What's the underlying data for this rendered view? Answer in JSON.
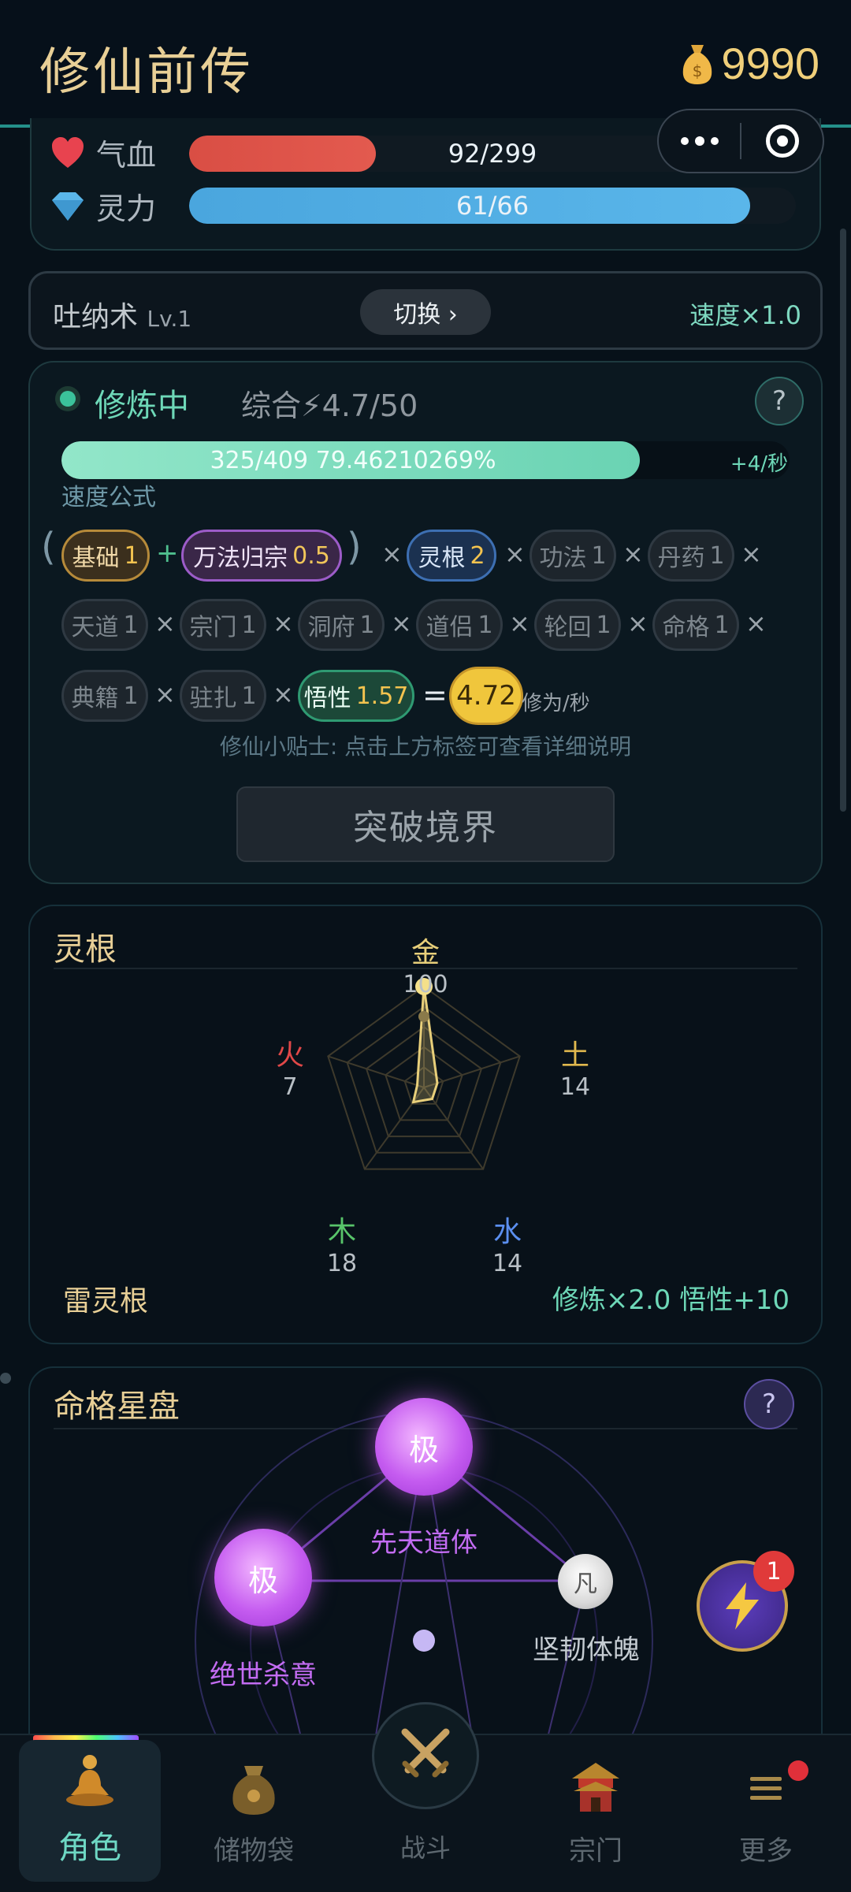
{
  "header": {
    "title": "修仙前传",
    "coins": "9990"
  },
  "stats": {
    "hp": {
      "label": "气血",
      "text": "92/299",
      "fraction": 0.3077,
      "color": "#e35a4f"
    },
    "mana": {
      "label": "灵力",
      "text": "61/66",
      "fraction": 0.9242,
      "color": "#5ab6ea"
    }
  },
  "technique": {
    "name": "吐纳术",
    "level": "Lv.1",
    "switch_label": "切换 ›",
    "speed": "速度×1.0"
  },
  "cultivation": {
    "status": "修炼中",
    "overall": "综合⚡4.7/50",
    "help": "?",
    "progress_text": "325/409  79.46210269%",
    "progress_fraction": 0.7946,
    "rate": "+4/秒",
    "formula_label": "速度公式",
    "chips": {
      "basic": {
        "name": "基础",
        "value": "1"
      },
      "wanfa": {
        "name": "万法归宗",
        "value": "0.5"
      },
      "lingen": {
        "name": "灵根",
        "value": "2"
      },
      "gongfa": {
        "name": "功法",
        "value": "1"
      },
      "danyao": {
        "name": "丹药",
        "value": "1"
      },
      "tiandao": {
        "name": "天道",
        "value": "1"
      },
      "zongmen": {
        "name": "宗门",
        "value": "1"
      },
      "dongfu": {
        "name": "洞府",
        "value": "1"
      },
      "daolv": {
        "name": "道侣",
        "value": "1"
      },
      "lunhui": {
        "name": "轮回",
        "value": "1"
      },
      "mingge": {
        "name": "命格",
        "value": "1"
      },
      "dianji": {
        "name": "典籍",
        "value": "1"
      },
      "zhuzha": {
        "name": "驻扎",
        "value": "1"
      },
      "wuxing": {
        "name": "悟性",
        "value": "1.57"
      }
    },
    "result": "4.72",
    "unit": "修为/秒",
    "tip": "修仙小贴士: 点击上方标签可查看详细说明",
    "breakthrough": "突破境界"
  },
  "spirit_root": {
    "title": "灵根",
    "elements": {
      "metal": {
        "name": "金",
        "value": "100",
        "color": "#e8cf7a"
      },
      "earth": {
        "name": "土",
        "value": "14",
        "color": "#e0b84e"
      },
      "water": {
        "name": "水",
        "value": "14",
        "color": "#5b8ff0"
      },
      "wood": {
        "name": "木",
        "value": "18",
        "color": "#58c46a"
      },
      "fire": {
        "name": "火",
        "value": "7",
        "color": "#e04848"
      }
    },
    "type": "雷灵根",
    "bonus": "修炼×2.0  悟性+10"
  },
  "star_chart": {
    "title": "命格星盘",
    "help": "?",
    "nodes": {
      "top": {
        "grade": "极",
        "name": "先天道体"
      },
      "left": {
        "grade": "极",
        "name": "绝世杀意"
      },
      "right": {
        "grade": "凡",
        "name": "坚韧体魄"
      }
    },
    "badge": "1"
  },
  "tabs": {
    "role": "角色",
    "bag": "储物袋",
    "battle": "战斗",
    "sect": "宗门",
    "more": "更多"
  }
}
